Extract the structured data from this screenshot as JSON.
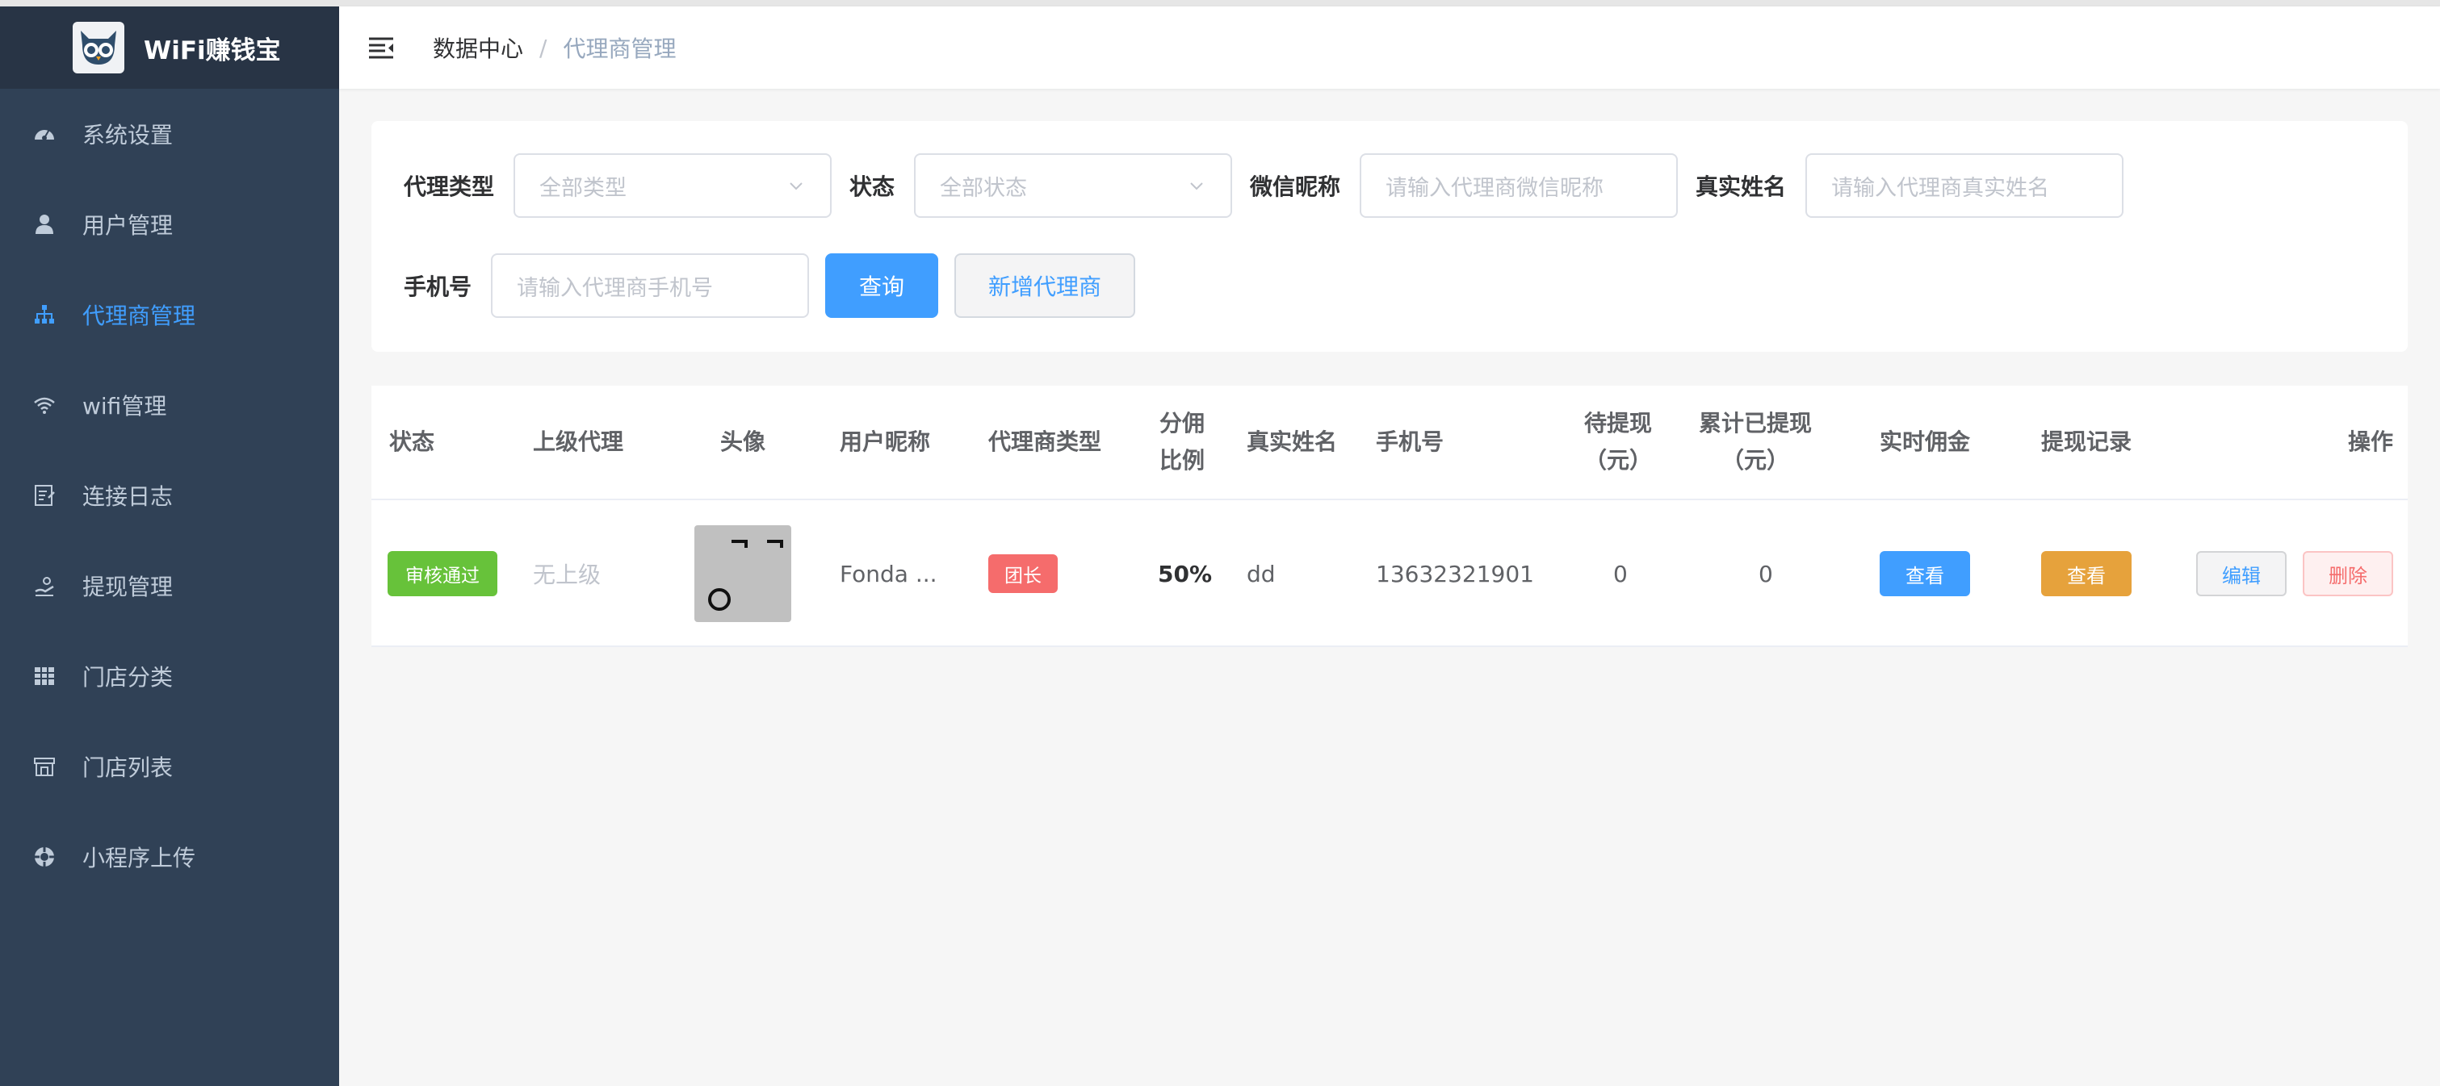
{
  "app": {
    "title": "WiFi赚钱宝"
  },
  "sidebar": {
    "items": [
      {
        "label": "系统设置",
        "icon": "dashboard-icon",
        "active": false
      },
      {
        "label": "用户管理",
        "icon": "user-icon",
        "active": false
      },
      {
        "label": "代理商管理",
        "icon": "org-tree-icon",
        "active": true
      },
      {
        "label": "wifi管理",
        "icon": "wifi-icon",
        "active": false
      },
      {
        "label": "连接日志",
        "icon": "log-icon",
        "active": false
      },
      {
        "label": "提现管理",
        "icon": "withdraw-icon",
        "active": false
      },
      {
        "label": "门店分类",
        "icon": "grid-icon",
        "active": false
      },
      {
        "label": "门店列表",
        "icon": "store-icon",
        "active": false
      },
      {
        "label": "小程序上传",
        "icon": "upload-icon",
        "active": false
      }
    ]
  },
  "breadcrumb": {
    "root": "数据中心",
    "separator": "/",
    "current": "代理商管理"
  },
  "filters": {
    "agent_type": {
      "label": "代理类型",
      "placeholder": "全部类型"
    },
    "status": {
      "label": "状态",
      "placeholder": "全部状态"
    },
    "wechat_nickname": {
      "label": "微信昵称",
      "placeholder": "请输入代理商微信昵称"
    },
    "real_name": {
      "label": "真实姓名",
      "placeholder": "请输入代理商真实姓名"
    },
    "phone": {
      "label": "手机号",
      "placeholder": "请输入代理商手机号"
    },
    "search_button": "查询",
    "add_button": "新增代理商"
  },
  "table": {
    "columns": {
      "status": "状态",
      "parent": "上级代理",
      "avatar": "头像",
      "nickname": "用户昵称",
      "type": "代理商类型",
      "ratio_line1": "分佣",
      "ratio_line2": "比例",
      "real_name": "真实姓名",
      "phone": "手机号",
      "pending_line1": "待提现",
      "pending_line2": "（元）",
      "withdrawn_line1": "累计已提现",
      "withdrawn_line2": "（元）",
      "commission": "实时佣金",
      "records": "提现记录",
      "actions": "操作"
    },
    "rows": [
      {
        "status": "审核通过",
        "parent": "无上级",
        "nickname": "Fonda ...",
        "type": "团长",
        "ratio": "50%",
        "real_name": "dd",
        "phone": "13632321901",
        "pending": "0",
        "withdrawn": "0",
        "commission_btn": "查看",
        "records_btn": "查看",
        "edit_btn": "编辑",
        "delete_btn": "删除"
      }
    ]
  },
  "colors": {
    "sidebar_bg": "#304156",
    "brand_bg": "#283445",
    "primary": "#409eff",
    "success": "#67c23a",
    "warning": "#e6a23c",
    "danger": "#f56c6c"
  }
}
